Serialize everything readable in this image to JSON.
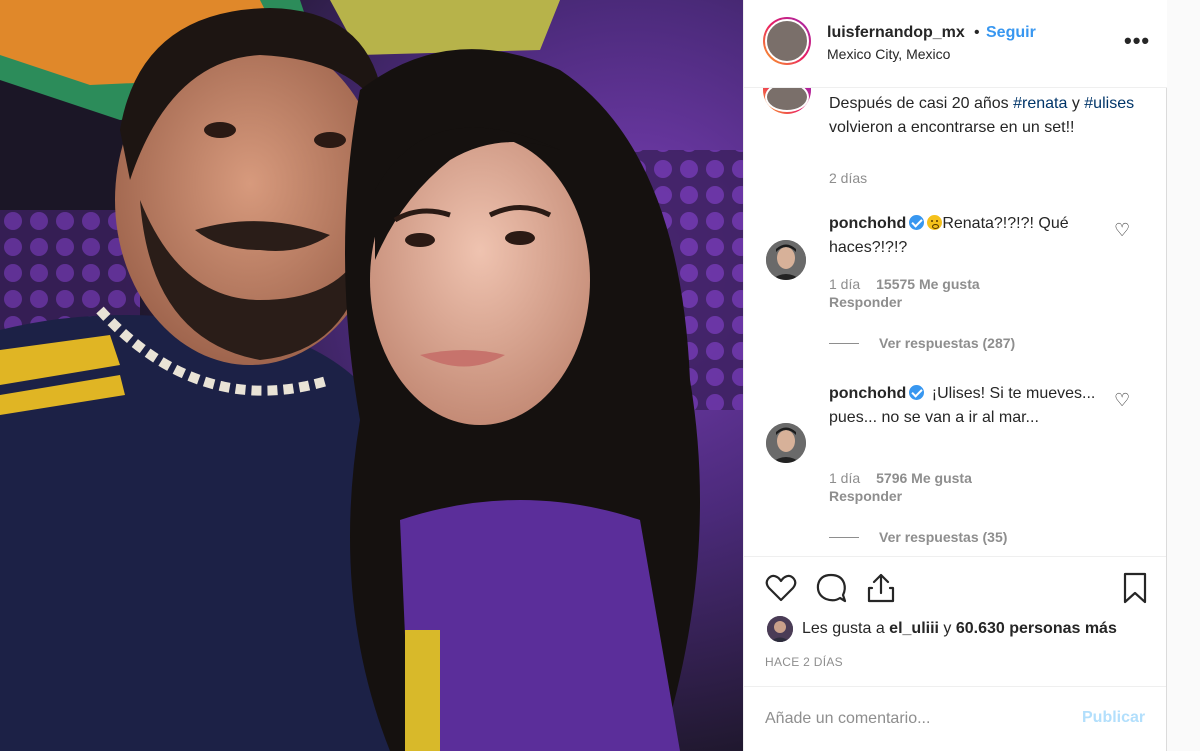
{
  "post": {
    "username": "luisfernandop_mx",
    "separator": "•",
    "follow_label": "Seguir",
    "location": "Mexico City, Mexico",
    "more_label": "•••"
  },
  "caption": {
    "text_1": "Después de casi 20 años ",
    "tag_1": "#renata",
    "text_2": " y ",
    "tag_2": "#ulises",
    "text_3": " volvieron a encontrarse en un set!!",
    "time": "2 días"
  },
  "comments": [
    {
      "user": "ponchohd",
      "text": "Renata?!?!?! Qué haces?!?!?",
      "time": "1 día",
      "likes": "15575 Me gusta",
      "reply_label": "Responder",
      "view_replies": "Ver respuestas (287)"
    },
    {
      "user": "ponchohd",
      "text": "¡Ulises! Si te mueves... pues... no se van a ir al mar...",
      "time": "1 día",
      "likes": "5796 Me gusta",
      "reply_label": "Responder",
      "view_replies": "Ver respuestas (35)"
    }
  ],
  "actions": {
    "like_icon": "heart-icon",
    "comment_icon": "comment-icon",
    "share_icon": "share-icon",
    "save_icon": "bookmark-icon",
    "likes_prefix": "Les gusta a ",
    "likes_user": "el_uliii",
    "likes_middle": " y ",
    "likes_count": "60.630 personas más",
    "post_time": "HACE 2 DÍAS"
  },
  "add_comment": {
    "placeholder": "Añade un comentario...",
    "publish_label": "Publicar"
  },
  "colors": {
    "accent": "#3897f0",
    "hashtag": "#003569",
    "muted": "#8e8e8e",
    "publish_disabled": "#b2dffc"
  }
}
